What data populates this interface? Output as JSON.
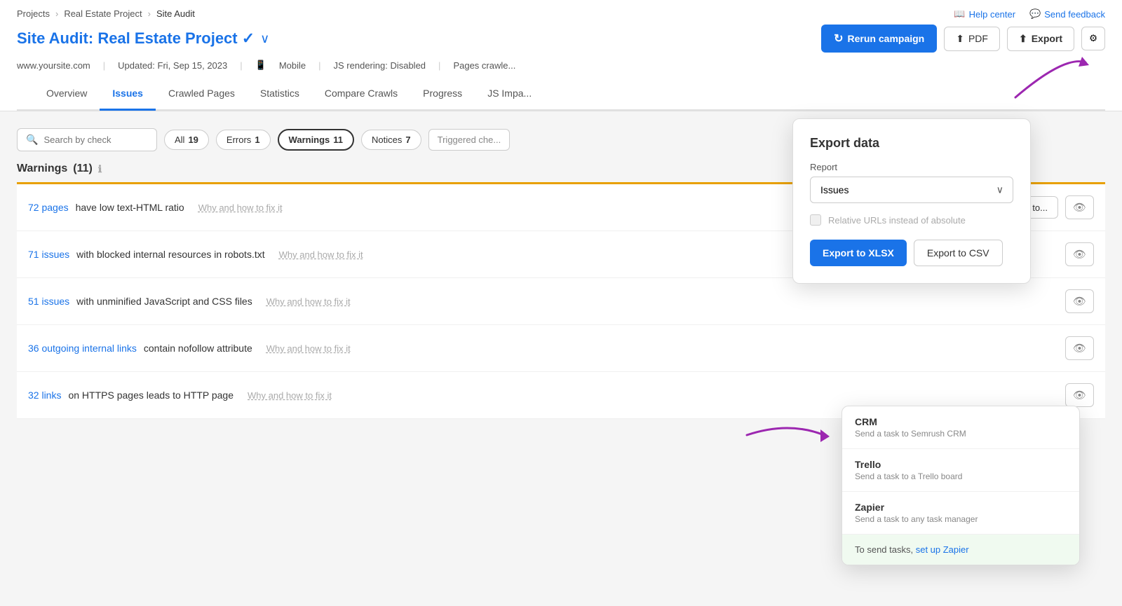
{
  "topNav": {
    "helpCenter": "Help center",
    "sendFeedback": "Send feedback"
  },
  "breadcrumb": {
    "projects": "Projects",
    "realEstateProject": "Real Estate Project",
    "siteAudit": "Site Audit"
  },
  "header": {
    "label": "Site Audit:",
    "projectName": "Real Estate Project",
    "btnRerun": "Rerun campaign",
    "btnPdf": "PDF",
    "btnExport": "Export",
    "metaUrl": "www.yoursite.com",
    "metaUpdated": "Updated: Fri, Sep 15, 2023",
    "metaDevice": "Mobile",
    "metaJs": "JS rendering: Disabled",
    "metaPages": "Pages crawle..."
  },
  "tabs": [
    {
      "id": "overview",
      "label": "Overview",
      "active": false
    },
    {
      "id": "issues",
      "label": "Issues",
      "active": true
    },
    {
      "id": "crawled-pages",
      "label": "Crawled Pages",
      "active": false
    },
    {
      "id": "statistics",
      "label": "Statistics",
      "active": false
    },
    {
      "id": "compare-crawls",
      "label": "Compare Crawls",
      "active": false
    },
    {
      "id": "progress",
      "label": "Progress",
      "active": false
    },
    {
      "id": "js-impact",
      "label": "JS Impa...",
      "active": false
    }
  ],
  "filters": {
    "searchPlaceholder": "Search by check",
    "allLabel": "All",
    "allCount": "19",
    "errorsLabel": "Errors",
    "errorsCount": "1",
    "warningsLabel": "Warnings",
    "warningsCount": "11",
    "noticesLabel": "Notices",
    "noticesCount": "7",
    "triggeredLabel": "Triggered che..."
  },
  "section": {
    "title": "Warnings",
    "count": "(11)"
  },
  "issues": [
    {
      "linkText": "72 pages",
      "text": " have low text-HTML ratio",
      "fix": "Why and how to fix it",
      "sendTo": true,
      "eyeVisible": true
    },
    {
      "linkText": "71 issues",
      "text": " with blocked internal resources in robots.txt",
      "fix": "Why and how to fix it",
      "sendTo": false,
      "eyeVisible": true
    },
    {
      "linkText": "51 issues",
      "text": " with unminified JavaScript and CSS files",
      "fix": "Why and how to fix it",
      "sendTo": false,
      "eyeVisible": true
    },
    {
      "linkText": "36 outgoing internal links",
      "text": " contain nofollow attribute",
      "fix": "Why and how to fix it",
      "sendTo": false,
      "eyeVisible": true
    },
    {
      "linkText": "32 links",
      "text": " on HTTPS pages leads to HTTP page",
      "fix": "Why and how to fix it",
      "sendTo": false,
      "eyeVisible": true
    }
  ],
  "exportPanel": {
    "title": "Export data",
    "reportLabel": "Report",
    "reportValue": "Issues",
    "relativeUrlsLabel": "Relative URLs instead of absolute",
    "btnXlsx": "Export to XLSX",
    "btnCsv": "Export to CSV"
  },
  "sendToPanel": {
    "btnLabel": "Send to...",
    "items": [
      {
        "title": "CRM",
        "desc": "Send a task to Semrush CRM"
      },
      {
        "title": "Trello",
        "desc": "Send a task to a Trello board"
      },
      {
        "title": "Zapier",
        "desc": "Send a task to any task manager"
      }
    ],
    "footerText": "To send tasks, ",
    "footerLinkText": "set up Zapier",
    "footerEnd": ""
  }
}
